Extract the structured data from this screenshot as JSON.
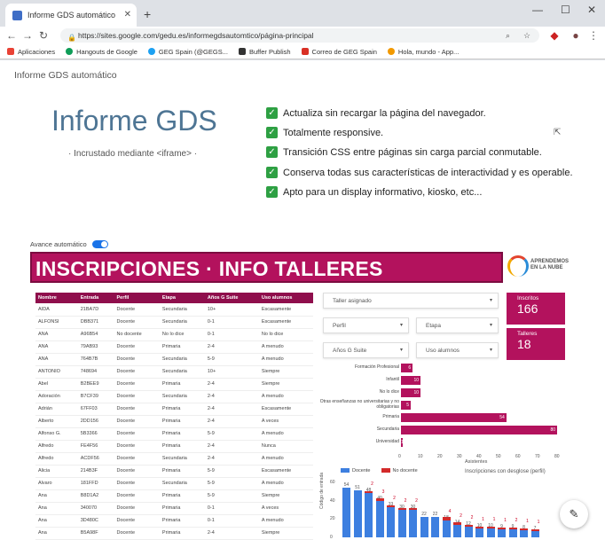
{
  "browser": {
    "tab_title": "Informe GDS automático",
    "url": "https://sites.google.com/gedu.es/informegdsautomtico/página-principal",
    "bookmarks": [
      "Aplicaciones",
      "Hangouts de Google",
      "GEG Spain (@GEGS...",
      "Buffer Publish",
      "Correo de GEG Spain",
      "Hola, mundo - App..."
    ]
  },
  "site": {
    "title": "Informe GDS automático",
    "hero": "Informe GDS",
    "hero_sub": "· Incrustado mediante <iframe> ·",
    "features": [
      "Actualiza sin recargar la página del navegador.",
      "Totalmente responsive.",
      "Transición CSS entre páginas sin carga parcial conmutable.",
      "Conserva todas sus características de interactividad y es operable.",
      "Apto para un display informativo, kiosko, etc..."
    ],
    "auto_label": "Avance automático"
  },
  "report": {
    "banner": "INSCRIPCIONES · INFO TALLERES",
    "logo_text": "APRENDEMOS EN LA NUBE",
    "table": {
      "headers": [
        "Nombre",
        "Entrada",
        "Perfil",
        "Etapa",
        "Años G Suite",
        "Uso alumnos"
      ],
      "rows": [
        [
          "AIDA",
          "21BA7D",
          "Docente",
          "Secundaria",
          "10+",
          "Escasamente"
        ],
        [
          "ALFONSI",
          "DBB371",
          "Docente",
          "Secundaria",
          "0-1",
          "Escasamente"
        ],
        [
          "ANA",
          "A96B54",
          "No docente",
          "No lo dice",
          "0-1",
          "No lo dice"
        ],
        [
          "ANA",
          "79AB93",
          "Docente",
          "Primaria",
          "2-4",
          "A menudo"
        ],
        [
          "ANA",
          "764B7B",
          "Docente",
          "Secundaria",
          "5-9",
          "A menudo"
        ],
        [
          "ANTONIO",
          "748694",
          "Docente",
          "Secundaria",
          "10+",
          "Siempre"
        ],
        [
          "Abel",
          "B2BEE9",
          "Docente",
          "Primaria",
          "2-4",
          "Siempre"
        ],
        [
          "Adoración",
          "B7CF39",
          "Docente",
          "Secundaria",
          "2-4",
          "A menudo"
        ],
        [
          "Adrián",
          "67FF03",
          "Docente",
          "Primaria",
          "2-4",
          "Escasamente"
        ],
        [
          "Alberto",
          "2DD156",
          "Docente",
          "Primaria",
          "2-4",
          "A veces"
        ],
        [
          "Alfonso G.",
          "5B3366",
          "Docente",
          "Primaria",
          "5-9",
          "A menudo"
        ],
        [
          "Alfredo",
          "FE4F56",
          "Docente",
          "Primaria",
          "2-4",
          "Nunca"
        ],
        [
          "Alfredo",
          "ACDF56",
          "Docente",
          "Secundaria",
          "2-4",
          "A menudo"
        ],
        [
          "Alicia",
          "214B3F",
          "Docente",
          "Primaria",
          "5-9",
          "Escasamente"
        ],
        [
          "Alvaro",
          "181FFD",
          "Docente",
          "Secundaria",
          "5-9",
          "A menudo"
        ],
        [
          "Ana",
          "B8D1A2",
          "Docente",
          "Primaria",
          "5-9",
          "Siempre"
        ],
        [
          "Ana",
          "340070",
          "Docente",
          "Primaria",
          "0-1",
          "A veces"
        ],
        [
          "Ana",
          "3D480C",
          "Docente",
          "Primaria",
          "0-1",
          "A menudo"
        ],
        [
          "Ana",
          "B5A98F",
          "Docente",
          "Primaria",
          "2-4",
          "Siempre"
        ]
      ]
    },
    "filters": {
      "taller": "Taller asignado",
      "perfil": "Perfil",
      "etapa": "Etapa",
      "anos": "Años G Suite",
      "uso": "Uso alumnos"
    },
    "kpis": {
      "inscritos_label": "Inscritos",
      "inscritos_value": "166",
      "talleres_label": "Talleres",
      "talleres_value": "18"
    }
  },
  "chart_data": [
    {
      "type": "bar",
      "orientation": "horizontal",
      "categories": [
        "Formación Profesional",
        "Infantil",
        "No lo dice",
        "Otras enseñanzas no universitarias y no obligatorias",
        "Primaria",
        "Secundaria",
        "Universidad"
      ],
      "values": [
        6,
        10,
        10,
        5,
        54,
        80,
        1
      ],
      "xlabel": "Asistentes",
      "xlim": [
        0,
        80
      ],
      "xticks": [
        0,
        10,
        20,
        30,
        40,
        50,
        60,
        70,
        80
      ]
    },
    {
      "type": "bar",
      "title": "Inscripciones con desglose (perfil)",
      "ylabel": "Código de entrada",
      "series": [
        {
          "name": "Docente",
          "values": [
            54,
            51,
            48,
            40,
            33,
            30,
            30,
            22,
            22,
            18,
            14,
            12,
            10,
            10,
            9,
            9,
            8,
            7
          ]
        },
        {
          "name": "No docente",
          "values": [
            null,
            null,
            2,
            3,
            2,
            2,
            2,
            null,
            null,
            4,
            2,
            2,
            1,
            1,
            1,
            2,
            1,
            1
          ]
        }
      ]
    }
  ]
}
